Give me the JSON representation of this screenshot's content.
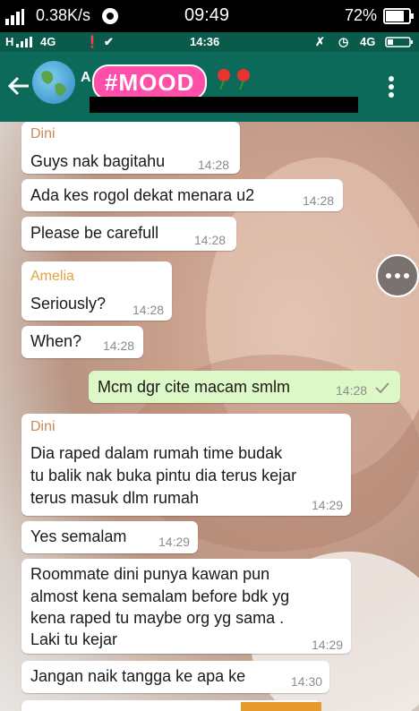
{
  "outer_status": {
    "net_speed": "0.38K/s",
    "time": "09:49",
    "battery": "72%"
  },
  "inner_status": {
    "signal": "H",
    "network": "4G",
    "time": "14:36",
    "network2": "4G"
  },
  "header": {
    "title": "#MOOD"
  },
  "messages": [
    {
      "sender": "Dini",
      "text": "Guys nak bagitahu",
      "time": "14:28"
    },
    {
      "text": "Ada kes rogol dekat menara u2",
      "time": "14:28"
    },
    {
      "text": "Please be carefull",
      "time": "14:28"
    },
    {
      "sender": "Amelia",
      "text": "Seriously?",
      "time": "14:28"
    },
    {
      "text": "When?",
      "time": "14:28"
    },
    {
      "text": "Mcm dgr cite macam smlm",
      "time": "14:28"
    },
    {
      "sender": "Dini",
      "line1": "Dia raped dalam rumah time budak",
      "line2": "tu balik nak buka pintu dia terus kejar",
      "line3": "terus masuk dlm rumah",
      "time": "14:29"
    },
    {
      "text": "Yes semalam",
      "time": "14:29"
    },
    {
      "line1": "Roommate dini punya kawan pun",
      "line2": "almost kena semalam before bdk yg",
      "line3": "kena raped tu maybe org yg sama .",
      "line4": "Laki tu kejar",
      "time": "14:29"
    },
    {
      "text": "Jangan naik tangga ke apa ke",
      "time": "14:30"
    }
  ],
  "colors": {
    "header": "#0b6a5a",
    "outgoing": "#dcf8c6",
    "dini": "#c98a57",
    "amelia": "#e2a33e"
  }
}
